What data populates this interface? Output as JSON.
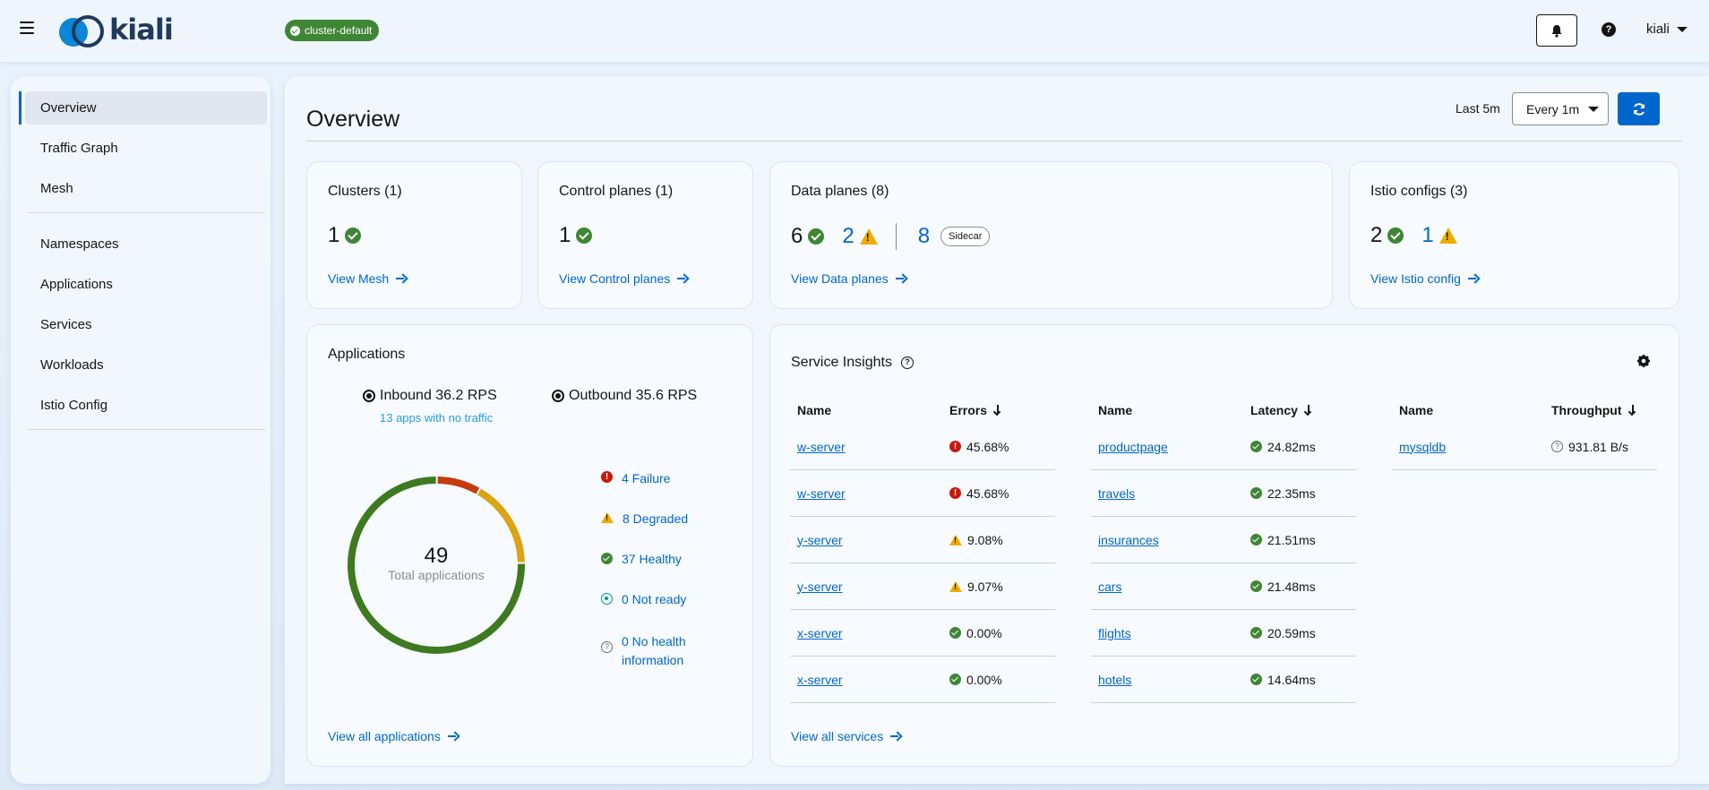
{
  "header": {
    "logo_text": "kiali",
    "cluster_badge": "cluster-default",
    "help_label": "?",
    "user": "kiali"
  },
  "sidebar": {
    "items": [
      {
        "label": "Overview"
      },
      {
        "label": "Traffic Graph"
      },
      {
        "label": "Mesh"
      },
      {
        "label": "Namespaces"
      },
      {
        "label": "Applications"
      },
      {
        "label": "Services"
      },
      {
        "label": "Workloads"
      },
      {
        "label": "Istio Config"
      }
    ]
  },
  "toolbar": {
    "title": "Overview",
    "duration": "Last 5m",
    "refresh_interval": "Every 1m"
  },
  "cards": {
    "clusters": {
      "title": "Clusters (1)",
      "healthy": "1",
      "link": "View Mesh"
    },
    "control_planes": {
      "title": "Control planes (1)",
      "healthy": "1",
      "link": "View Control planes"
    },
    "data_planes": {
      "title": "Data planes (8)",
      "healthy": "6",
      "warning": "2",
      "sidecar_count": "8",
      "sidecar_label": "Sidecar",
      "link": "View Data planes"
    },
    "istio_configs": {
      "title": "Istio configs (3)",
      "healthy": "2",
      "warning": "1",
      "link": "View Istio config"
    }
  },
  "applications": {
    "title": "Applications",
    "inbound": "Inbound 36.2 RPS",
    "outbound": "Outbound 35.6 RPS",
    "no_traffic": "13 apps with no traffic",
    "total": "49",
    "total_label": "Total applications",
    "legend": {
      "failure": "4 Failure",
      "degraded": "8 Degraded",
      "healthy": "37 Healthy",
      "not_ready": "0 Not ready",
      "no_health_1": "0 No health",
      "no_health_2": "information"
    },
    "donut": {
      "failure": 4,
      "degraded": 8,
      "healthy": 37,
      "colors": {
        "failure": "#c9390f",
        "degraded": "#dba416",
        "healthy": "#3e7a1f"
      }
    },
    "link": "View all applications"
  },
  "insights": {
    "title": "Service Insights",
    "errors": {
      "col_name": "Name",
      "col_value": "Errors",
      "rows": [
        {
          "name": "w-server",
          "value": "45.68%",
          "status": "error"
        },
        {
          "name": "w-server",
          "value": "45.68%",
          "status": "error"
        },
        {
          "name": "y-server",
          "value": "9.08%",
          "status": "warning"
        },
        {
          "name": "y-server",
          "value": "9.07%",
          "status": "warning"
        },
        {
          "name": "x-server",
          "value": "0.00%",
          "status": "ok"
        },
        {
          "name": "x-server",
          "value": "0.00%",
          "status": "ok"
        }
      ]
    },
    "latency": {
      "col_name": "Name",
      "col_value": "Latency",
      "rows": [
        {
          "name": "productpage",
          "value": "24.82ms"
        },
        {
          "name": "travels",
          "value": "22.35ms"
        },
        {
          "name": "insurances",
          "value": "21.51ms"
        },
        {
          "name": "cars",
          "value": "21.48ms"
        },
        {
          "name": "flights",
          "value": "20.59ms"
        },
        {
          "name": "hotels",
          "value": "14.64ms"
        }
      ]
    },
    "throughput": {
      "col_name": "Name",
      "col_value": "Throughput",
      "rows": [
        {
          "name": "mysqldb",
          "value": "931.81 B/s"
        }
      ]
    },
    "link": "View all services"
  }
}
